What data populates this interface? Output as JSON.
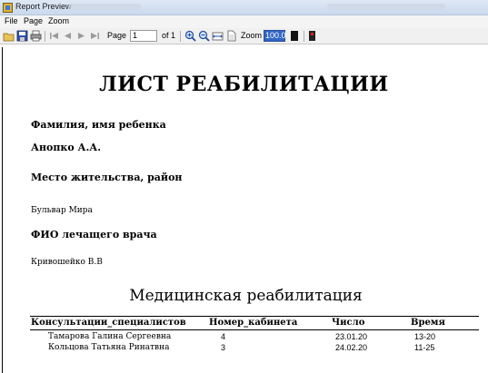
{
  "window": {
    "title": "Report Preview"
  },
  "menu": {
    "file": "File",
    "page": "Page",
    "zoom": "Zoom"
  },
  "toolbar": {
    "page_label": "Page",
    "page_value": "1",
    "of_label": "of 1",
    "zoom_label": "Zoom",
    "zoom_value": "100.0"
  },
  "document": {
    "title": "ЛИСТ РЕАБИЛИТАЦИИ",
    "child_name_label": "Фамилия, имя ребенка",
    "child_name_value": "Анопко А.А.",
    "residence_label": "Место жительства, район",
    "residence_value": "Бульвар Мира",
    "doctor_label": "ФИО лечащего врача",
    "doctor_value": "Кривошейко В.В",
    "section_title": "Медицинская реабилитация",
    "table": {
      "columns": [
        "Консультации_специалистов",
        "Номер_кабинета",
        "Число",
        "Время"
      ],
      "rows": [
        [
          "Тамарова Галина Сергеевна",
          "4",
          "23.01.20",
          "13-20"
        ],
        [
          "Кольцова Татьяна Ринатвна",
          "3",
          "24.02.20",
          "11-25"
        ]
      ]
    }
  }
}
